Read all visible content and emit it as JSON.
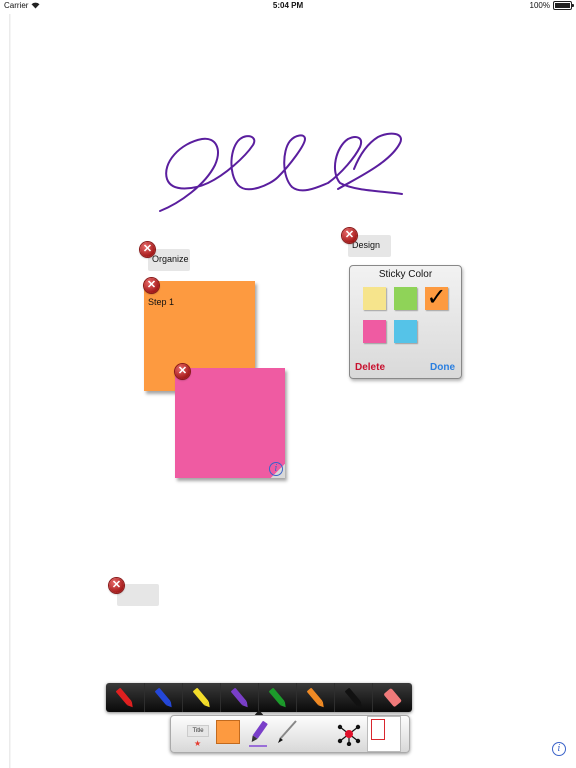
{
  "status_bar": {
    "carrier": "Carrier",
    "time": "5:04 PM",
    "battery_text": "100%",
    "battery_level": 1.0
  },
  "tags": [
    {
      "label": "Organize"
    },
    {
      "label": "Design"
    },
    {
      "label": ""
    }
  ],
  "stickies": [
    {
      "label": "Step 1",
      "color": "#fd9a40"
    },
    {
      "label": "",
      "color": "#ef5ba2"
    }
  ],
  "color_popup": {
    "title": "Sticky Color",
    "colors": [
      "#f6e48c",
      "#8fd358",
      "#fd9a40",
      "#ef5ba2",
      "#55c3e8"
    ],
    "selected_color": "#fd9a40",
    "check_glyph": "✓",
    "delete_label": "Delete",
    "done_label": "Done"
  },
  "pens": [
    {
      "name": "red",
      "color": "#e02020"
    },
    {
      "name": "blue",
      "color": "#2447d8"
    },
    {
      "name": "yellow",
      "color": "#f3dd2a"
    },
    {
      "name": "purple",
      "color": "#7a3fc9"
    },
    {
      "name": "green",
      "color": "#1c9b2b"
    },
    {
      "name": "orange",
      "color": "#f08a24"
    },
    {
      "name": "black",
      "color": "#111111"
    },
    {
      "name": "eraser",
      "color": "#f07a7a"
    }
  ],
  "toolbar": {
    "title_label": "Title",
    "star_glyph": "★",
    "sticky_color": "#fd9a40"
  },
  "ink_color": "#5a1e9e",
  "info_glyph": "i"
}
